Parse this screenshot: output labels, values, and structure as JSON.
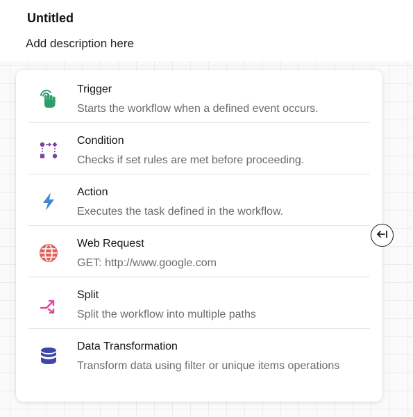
{
  "header": {
    "title": "Untitled",
    "description": "Add description here"
  },
  "node_menu": {
    "items": [
      {
        "title": "Trigger",
        "subtitle": "Starts the workflow when a defined event occurs.",
        "icon": "hand-tap-icon",
        "color": "#2e9e6b"
      },
      {
        "title": "Condition",
        "subtitle": "Checks if set rules are met before proceeding.",
        "icon": "condition-nodes-icon",
        "color": "#7a3fa1"
      },
      {
        "title": "Action",
        "subtitle": "Executes the task defined in the workflow.",
        "icon": "lightning-bolt-icon",
        "color": "#3f8ad0"
      },
      {
        "title": "Web Request",
        "subtitle": "GET: http://www.google.com",
        "icon": "globe-icon",
        "color": "#e0645c"
      },
      {
        "title": "Split",
        "subtitle": "Split the workflow into multiple paths",
        "icon": "split-arrows-icon",
        "color": "#e0489a"
      },
      {
        "title": "Data Transformation",
        "subtitle": "Transform data using filter or unique items operations",
        "icon": "database-icon",
        "color": "#3e47a8"
      }
    ]
  },
  "collapse_button": {
    "icon": "collapse-left-icon"
  }
}
